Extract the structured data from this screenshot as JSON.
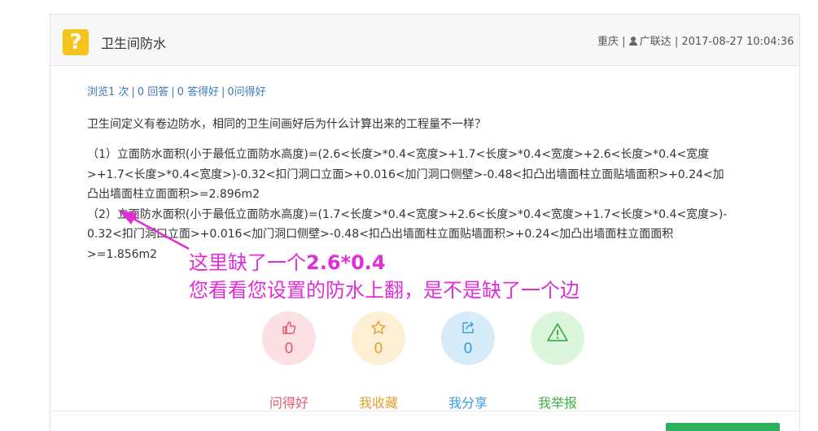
{
  "header": {
    "title": "卫生间防水",
    "location": "重庆",
    "username": "广联达",
    "datetime": "2017-08-27 10:04:36"
  },
  "stats": {
    "views": "浏览1 次",
    "answers": "0 回答",
    "good_answers": "0 答得好",
    "asked_good": "0问得好"
  },
  "question_text": "卫生间定义有卷边防水，相同的卫生间画好后为什么计算出来的工程量不一样？",
  "answer_lines": [
    "（1）立面防水面积(小于最低立面防水高度)=(2.6<长度>*0.4<宽度>+1.7<长度>*0.4<宽度>+2.6<长度>*0.4<宽度",
    ">+1.7<长度>*0.4<宽度>)-0.32<扣门洞口立面>+0.016<加门洞口侧壁>-0.48<扣凸出墙面柱立面贴墙面积>+0.24<加",
    "凸出墙面柱立面面积>=2.896m2",
    "（2）立面防水面积(小于最低立面防水高度)=(1.7<长度>*0.4<宽度>+2.6<长度>*0.4<宽度>+1.7<长度>*0.4<宽度>)-",
    "0.32<扣门洞口立面>+0.016<加门洞口侧壁>-0.48<扣凸出墙面柱立面贴墙面积>+0.24<加凸出墙面柱立面面积",
    ">=1.856m2"
  ],
  "annotation": {
    "line1_prefix": "这里缺了一个",
    "line1_value": "2.6*0.4",
    "line2": "您看看您设置的防水上翻，是不是缺了一个边",
    "color": "#e02dd6"
  },
  "actions": [
    {
      "label": "问得好",
      "count": "0",
      "icon": "thumbs-up-icon",
      "bg": "#fde0e3",
      "color": "#e05a6a"
    },
    {
      "label": "我收藏",
      "count": "0",
      "icon": "star-icon",
      "bg": "#fdefd3",
      "color": "#e0a030"
    },
    {
      "label": "我分享",
      "count": "0",
      "icon": "share-icon",
      "bg": "#d6ecfb",
      "color": "#3a9de0"
    },
    {
      "label": "我举报",
      "count": "0",
      "icon": "warning-icon",
      "bg": "#dcf5dd",
      "color": "#3fae4a"
    }
  ]
}
